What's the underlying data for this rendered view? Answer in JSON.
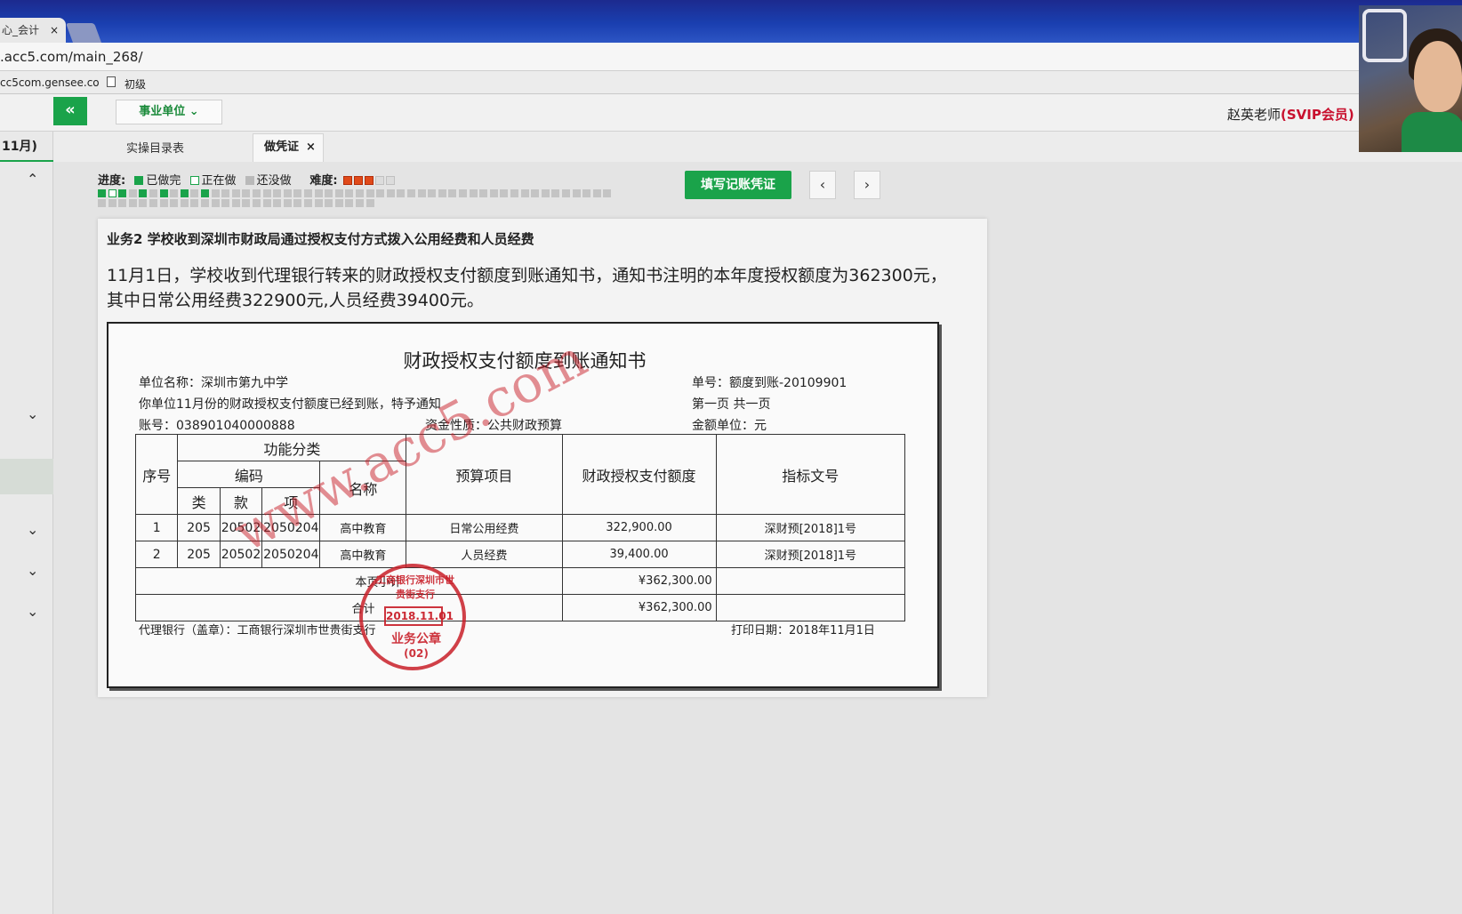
{
  "browser": {
    "tab_title": "心_会计",
    "tab_close": "×",
    "url": ".acc5.com/main_268/",
    "bookmark_1": "cc5com.gensee.co",
    "bookmark_2": "初级"
  },
  "header": {
    "collapse": "«",
    "unit_type": "事业单位 ⌄",
    "teacher": "赵英老师",
    "membership": "(SVIP会员)"
  },
  "sidebar": {
    "month": "11月)",
    "chevrons": [
      "⌃",
      "⌄",
      "⌄",
      "⌄",
      "⌄"
    ]
  },
  "tabs": {
    "catalog": "实操目录表",
    "voucher": "做凭证",
    "voucher_close": "×"
  },
  "progress": {
    "label": "进度:",
    "done": "已做完",
    "doing": "正在做",
    "todo": "还没做",
    "difficulty_label": "难度:",
    "difficulty_rating": 3,
    "difficulty_max": 5,
    "cells": [
      "done",
      "doing",
      "done",
      "todo",
      "done",
      "todo",
      "done",
      "todo",
      "done",
      "todo",
      "done",
      "todo",
      "todo",
      "todo",
      "todo",
      "todo",
      "todo",
      "todo",
      "todo",
      "todo",
      "todo",
      "todo",
      "todo",
      "todo",
      "todo",
      "todo",
      "todo",
      "todo",
      "todo",
      "todo",
      "todo",
      "todo",
      "todo",
      "todo",
      "todo",
      "todo",
      "todo",
      "todo",
      "todo",
      "todo",
      "todo",
      "todo",
      "todo",
      "todo",
      "todo",
      "todo",
      "todo",
      "todo",
      "todo",
      "todo",
      "todo",
      "todo",
      "todo",
      "todo",
      "todo",
      "todo",
      "todo",
      "todo",
      "todo",
      "todo",
      "todo",
      "todo",
      "todo",
      "todo",
      "todo",
      "todo",
      "todo",
      "todo",
      "todo",
      "todo",
      "todo",
      "todo",
      "todo",
      "todo",
      "todo",
      "todo",
      "todo"
    ]
  },
  "actions": {
    "fill_voucher": "填写记账凭证",
    "prev": "‹",
    "next": "›"
  },
  "business": {
    "title": "业务2 学校收到深圳市财政局通过授权支付方式拨入公用经费和人员经费",
    "description": "11月1日，学校收到代理银行转来的财政授权支付额度到账通知书，通知书注明的本年度授权额度为362300元，其中日常公用经费322900元,人员经费39400元。"
  },
  "notice": {
    "title": "财政授权支付额度到账通知书",
    "unit_name": "单位名称：深圳市第九中学",
    "doc_no": "单号：额度到账-20109901",
    "notify": "你单位11月份的财政授权支付额度已经到账，特予通知",
    "page": "第一页  共一页",
    "account": "账号：038901040000888",
    "fund_nature": "资金性质：公共财政预算",
    "amount_unit": "金额单位：元",
    "headers": {
      "seq": "序号",
      "func_class": "功能分类",
      "code": "编码",
      "name": "名称",
      "lei": "类",
      "kuan": "款",
      "xiang": "项",
      "budget_item": "预算项目",
      "amount": "财政授权支付额度",
      "doc_ref": "指标文号"
    },
    "rows": [
      {
        "seq": "1",
        "lei": "205",
        "kuan": "20502",
        "xiang": "2050204",
        "name": "高中教育",
        "budget_item": "日常公用经费",
        "amount": "322,900.00",
        "doc_ref": "深财预[2018]1号"
      },
      {
        "seq": "2",
        "lei": "205",
        "kuan": "20502",
        "xiang": "2050204",
        "name": "高中教育",
        "budget_item": "人员经费",
        "amount": "39,400.00",
        "doc_ref": "深财预[2018]1号"
      }
    ],
    "subtotal_label": "本页小计",
    "subtotal": "¥362,300.00",
    "total_label": "合计",
    "total": "¥362,300.00",
    "agent_bank": "代理银行（盖章）：工商银行深圳市世贵街支行",
    "print_date": "打印日期：2018年11月1日",
    "watermark": "www.acc5.com",
    "stamp": {
      "arc": "工商银行深圳市世贵街支行",
      "date": "2018.11.01",
      "line1": "业务公章",
      "line2": "(02)"
    }
  },
  "colors": {
    "accent": "#1aa34a",
    "stamp": "#c8102e"
  }
}
